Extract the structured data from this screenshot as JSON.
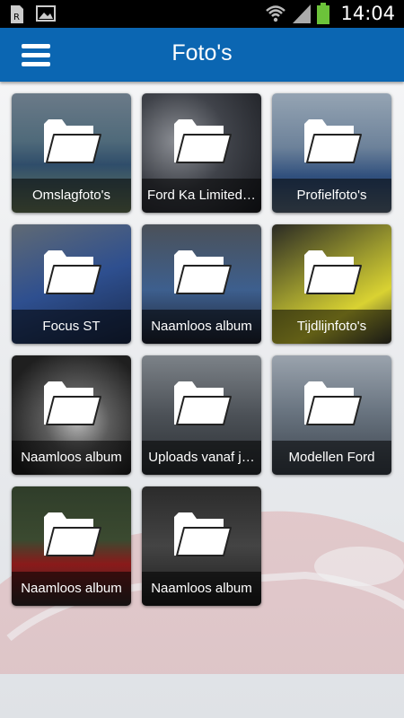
{
  "status_bar": {
    "time": "14:04",
    "icons": [
      "sim-icon",
      "image-icon",
      "wifi-icon",
      "signal-icon",
      "battery-icon"
    ]
  },
  "header": {
    "title": "Foto's",
    "menu_icon": "hamburger-menu-icon",
    "color": "#0b66b2"
  },
  "albums": [
    {
      "label": "Omslagfoto's"
    },
    {
      "label": "Ford Ka Limited…"
    },
    {
      "label": "Profielfoto's"
    },
    {
      "label": "Focus ST"
    },
    {
      "label": "Naamloos album"
    },
    {
      "label": "Tijdlijnfoto's"
    },
    {
      "label": "Naamloos album"
    },
    {
      "label": "Uploads vanaf j…"
    },
    {
      "label": "Modellen Ford"
    },
    {
      "label": "Naamloos album"
    },
    {
      "label": "Naamloos album"
    }
  ],
  "folder_icon": "folder-icon"
}
